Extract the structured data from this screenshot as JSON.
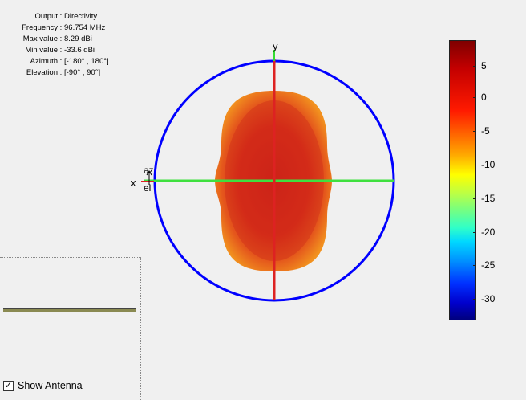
{
  "info": {
    "output_label": "Output",
    "output_value": "Directivity",
    "frequency_label": "Frequency",
    "frequency_value": "96.754 MHz",
    "max_label": "Max value",
    "max_value": "8.29 dBi",
    "min_label": "Min value",
    "min_value": "-33.6 dBi",
    "azimuth_label": "Azimuth",
    "azimuth_value": "[-180° , 180°]",
    "elevation_label": "Elevation",
    "elevation_value": "[-90° , 90°]"
  },
  "axes": {
    "x_label": "x",
    "y_label": "y",
    "az_label": "az",
    "el_label": "el"
  },
  "colorbar": {
    "ticks": [
      "5",
      "0",
      "-5",
      "-10",
      "-15",
      "-20",
      "-25",
      "-30"
    ]
  },
  "show_antenna": {
    "label": "Show Antenna",
    "checked": true,
    "check_glyph": "✓"
  },
  "colors": {
    "circle": "#0000ff",
    "x_axis": "#33dd33",
    "y_axis": "#dd2222",
    "pattern_core": "#d42a1a",
    "pattern_edge": "#f08a1e"
  }
}
